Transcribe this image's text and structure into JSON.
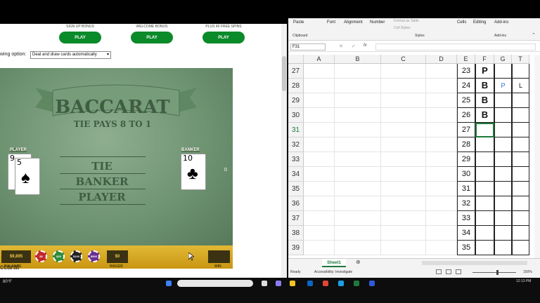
{
  "browser": {
    "bonuses": [
      {
        "label": "SIGN UP BONUS",
        "button": "PLAY"
      },
      {
        "label": "WELCOME BONUS",
        "button": "PLAY"
      },
      {
        "label": "PLUS 40 FREE SPINS",
        "button": "PLAY"
      }
    ],
    "viewing_option_label": "wing option:",
    "viewing_option_value": "Deal and draw cards automatically",
    "page_title_fragment": "ccarat"
  },
  "game": {
    "title": "BACCARAT",
    "subtitle": "TIE PAYS 8 TO 1",
    "zones": [
      "TIE",
      "BANKER",
      "PLAYER"
    ],
    "player_label": "PLAYER",
    "banker_label": "BANKER",
    "banker_score": "0",
    "player_cards": [
      {
        "rank": "9",
        "suit": "♠"
      },
      {
        "rank": "5",
        "suit": "♠"
      }
    ],
    "banker_cards": [
      {
        "rank": "10",
        "suit": "♣"
      }
    ],
    "balance_value": "$9,895",
    "balance_label": "BALANCE",
    "chips": [
      {
        "value": "$5",
        "color": "#c0282c"
      },
      {
        "value": "$25",
        "color": "#2e8b3a"
      },
      {
        "value": "$100",
        "color": "#222222"
      },
      {
        "value": "$500",
        "color": "#6b2f8f"
      }
    ],
    "wager_value": "$0",
    "wager_label": "WAGER",
    "win_value": "",
    "win_label": "WIN"
  },
  "excel": {
    "ribbon_groups": [
      {
        "name": "Paste",
        "caption": "Clipboard"
      },
      {
        "name": "Font",
        "caption": ""
      },
      {
        "name": "Alignment",
        "caption": ""
      },
      {
        "name": "Number",
        "caption": ""
      },
      {
        "name": "Format as Table",
        "caption": "Styles"
      },
      {
        "name": "Cell Styles",
        "caption": ""
      },
      {
        "name": "Cells",
        "caption": ""
      },
      {
        "name": "Editing",
        "caption": ""
      },
      {
        "name": "Add-ins",
        "caption": "Add-ins"
      }
    ],
    "name_box": "F31",
    "fx_label": "fx",
    "columns": [
      "A",
      "B",
      "C",
      "D",
      "E",
      "F",
      "G",
      "T"
    ],
    "rows": [
      {
        "num": "27",
        "E": "23",
        "F": "P",
        "G": "",
        "T": ""
      },
      {
        "num": "28",
        "E": "24",
        "F": "B",
        "G": "P",
        "T": "L"
      },
      {
        "num": "29",
        "E": "25",
        "F": "B",
        "G": "",
        "T": ""
      },
      {
        "num": "30",
        "E": "26",
        "F": "B",
        "G": "",
        "T": ""
      },
      {
        "num": "31",
        "E": "27",
        "F": "",
        "G": "",
        "T": ""
      },
      {
        "num": "32",
        "E": "28",
        "F": "",
        "G": "",
        "T": ""
      },
      {
        "num": "33",
        "E": "29",
        "F": "",
        "G": "",
        "T": ""
      },
      {
        "num": "34",
        "E": "30",
        "F": "",
        "G": "",
        "T": ""
      },
      {
        "num": "35",
        "E": "31",
        "F": "",
        "G": "",
        "T": ""
      },
      {
        "num": "36",
        "E": "32",
        "F": "",
        "G": "",
        "T": ""
      },
      {
        "num": "37",
        "E": "33",
        "F": "",
        "G": "",
        "T": ""
      },
      {
        "num": "38",
        "E": "34",
        "F": "",
        "G": "",
        "T": ""
      },
      {
        "num": "39",
        "E": "35",
        "F": "",
        "G": "",
        "T": ""
      }
    ],
    "sheet_tab": "Sheet1",
    "status_ready": "Ready",
    "status_accessibility": "Accessibility: Investigate",
    "zoom": "150%",
    "colors": {
      "accent": "#1d7a3a",
      "g_text": "#2a6ed1"
    }
  },
  "taskbar": {
    "weather": "80°F",
    "clock": "12:13 PM"
  }
}
